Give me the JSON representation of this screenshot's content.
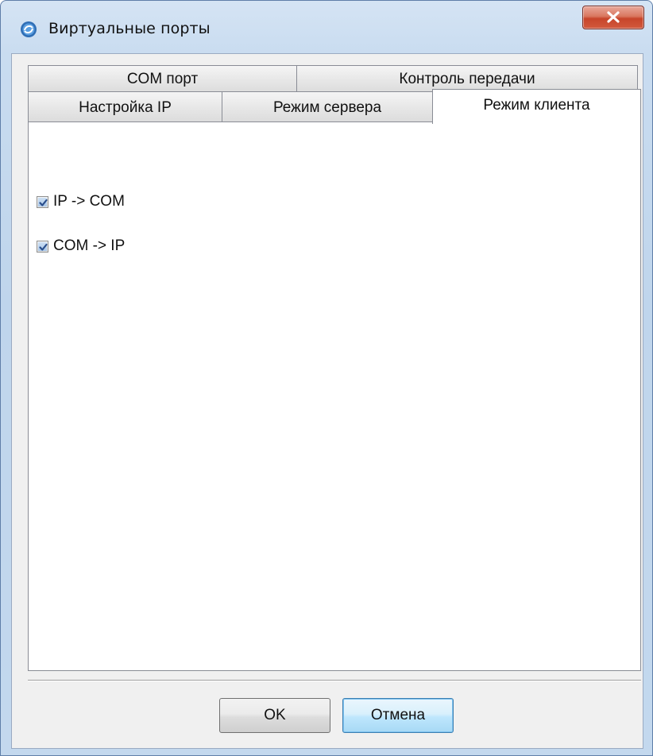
{
  "window": {
    "title": "Виртуальные порты",
    "icon": "app-logo-icon",
    "close_icon": "close-icon"
  },
  "tabs": {
    "row1": [
      {
        "label": "COM порт"
      },
      {
        "label": "Контроль передачи"
      }
    ],
    "row2": [
      {
        "label": "Настройка IP"
      },
      {
        "label": "Режим сервера"
      },
      {
        "label": "Режим клиента",
        "active": true
      }
    ]
  },
  "panel": {
    "checkboxes": [
      {
        "label": "IP -> COM",
        "checked": true
      },
      {
        "label": "COM -> IP",
        "checked": true
      }
    ]
  },
  "buttons": {
    "ok_label": "OK",
    "cancel_label": "Отмена"
  },
  "colors": {
    "frame": "#c3d8ee",
    "close_button": "#c7452a",
    "default_button": "#3c7fb1"
  }
}
